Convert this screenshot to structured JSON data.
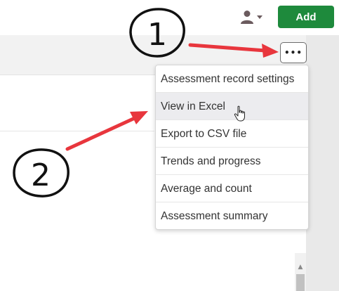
{
  "header": {
    "user_menu_icon": "user-icon",
    "user_menu_chevron": "caret-down-icon",
    "add_label": "Add",
    "accent_color": "#1e8a3c"
  },
  "more_button": {
    "label": "•••",
    "icon": "more-horizontal-icon"
  },
  "menu": {
    "items": [
      {
        "label": "Assessment record settings"
      },
      {
        "label": "View in Excel",
        "hovered": true
      },
      {
        "label": "Export to CSV file"
      },
      {
        "label": "Trends and progress"
      },
      {
        "label": "Average and count"
      },
      {
        "label": "Assessment summary"
      }
    ]
  },
  "annotations": {
    "step1": "1",
    "step2": "2",
    "arrow_color": "#e8363d"
  },
  "scrollbar": {
    "up_arrow": "▲"
  }
}
